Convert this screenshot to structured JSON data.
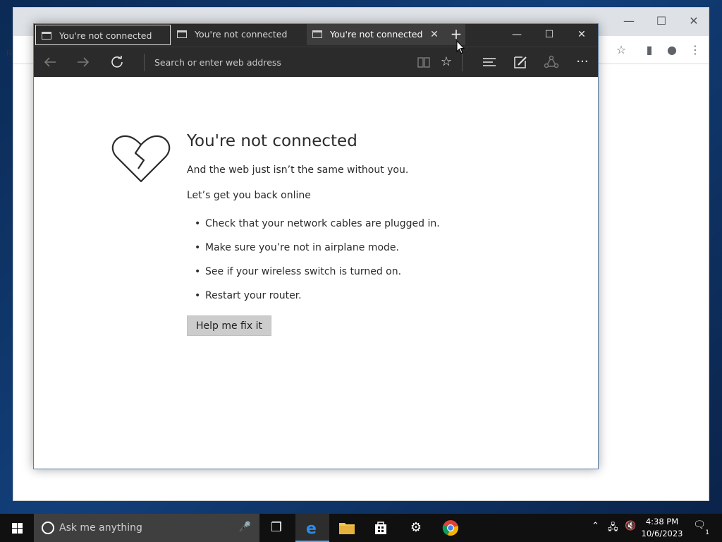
{
  "edge": {
    "tabs": [
      {
        "label": "You're not connected"
      },
      {
        "label": "You're not connected"
      },
      {
        "label": "You're not connected"
      }
    ],
    "address_placeholder": "Search or enter web address",
    "page": {
      "heading": "You're not connected",
      "subtext": "And the web just isn’t the same without you.",
      "back_online": "Let’s get you back online",
      "tips": [
        "Check that your network cables are plugged in.",
        "Make sure you’re not in airplane mode.",
        "See if your wireless switch is turned on.",
        "Restart your router."
      ],
      "fix_button": "Help me fix it"
    }
  },
  "background_window": {
    "left_text": "R"
  },
  "taskbar": {
    "search_placeholder": "Ask me anything",
    "clock_time": "4:38 PM",
    "clock_date": "10/6/2023",
    "notification_count": "1"
  },
  "colors": {
    "edge_chrome": "#2b2b2b",
    "taskbar": "#101010",
    "accent": "#0078d7"
  }
}
